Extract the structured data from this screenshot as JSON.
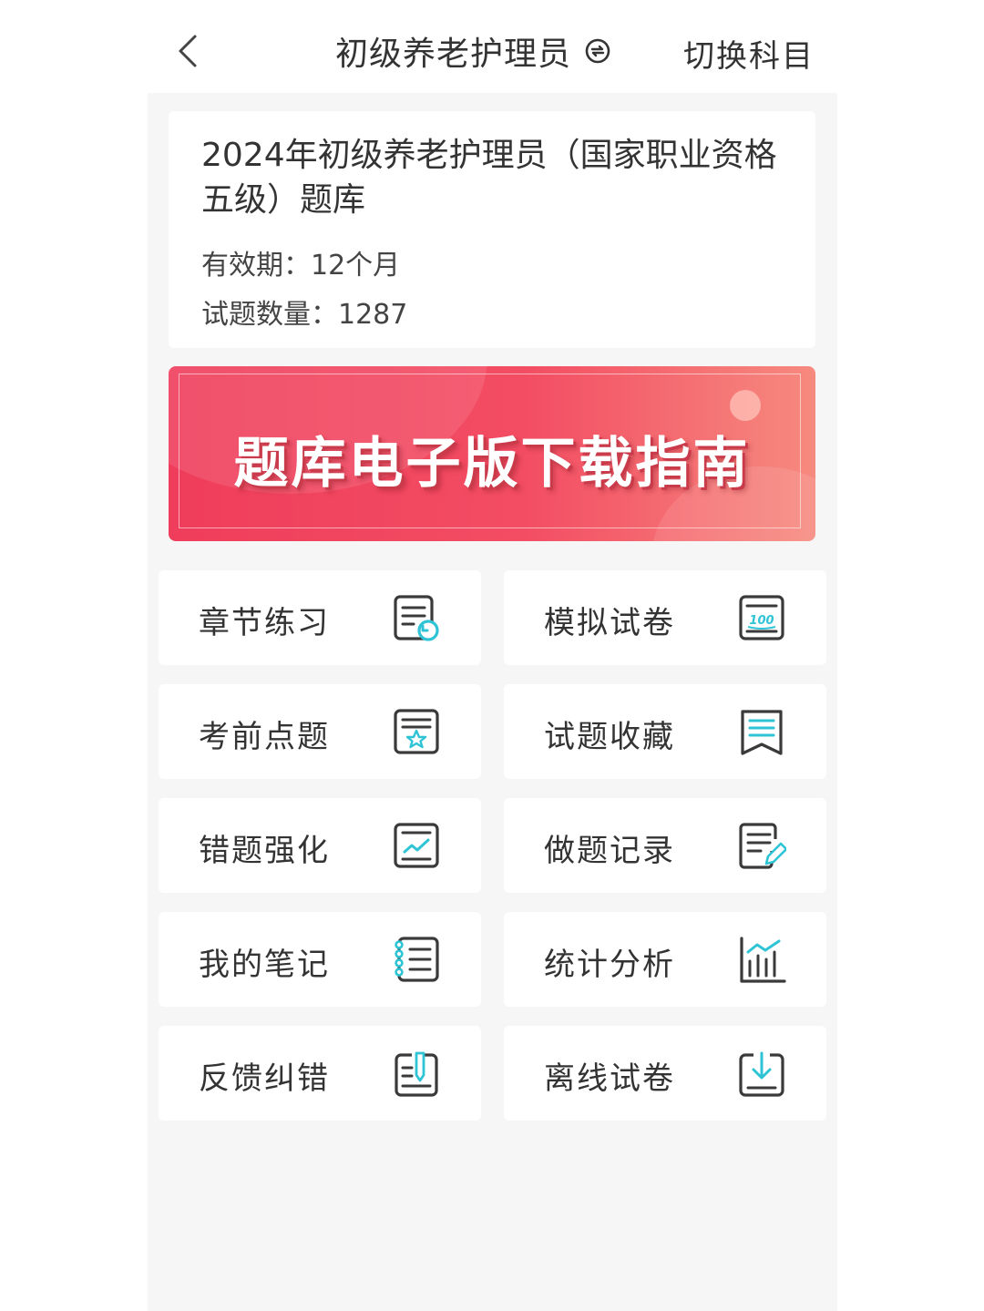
{
  "header": {
    "title": "初级养老护理员",
    "switch_label": "切换科目"
  },
  "info": {
    "title": "2024年初级养老护理员（国家职业资格五级）题库",
    "validity": "有效期：12个月",
    "question_count": "试题数量：1287"
  },
  "banner": {
    "text": "题库电子版下载指南"
  },
  "menu": [
    {
      "label": "章节练习",
      "icon": "chapter-practice-icon"
    },
    {
      "label": "模拟试卷",
      "icon": "mock-exam-icon"
    },
    {
      "label": "考前点题",
      "icon": "pre-exam-tips-icon"
    },
    {
      "label": "试题收藏",
      "icon": "bookmark-icon"
    },
    {
      "label": "错题强化",
      "icon": "wrong-question-icon"
    },
    {
      "label": "做题记录",
      "icon": "record-edit-icon"
    },
    {
      "label": "我的笔记",
      "icon": "notebook-icon"
    },
    {
      "label": "统计分析",
      "icon": "bar-chart-icon"
    },
    {
      "label": "反馈纠错",
      "icon": "feedback-icon"
    },
    {
      "label": "离线试卷",
      "icon": "download-icon"
    }
  ],
  "colors": {
    "accent": "#2ec4d6",
    "icon_stroke": "#3a3a3a",
    "banner_red": "#ef3d5b",
    "banner_pink": "#f68a7f",
    "background": "#f6f6f7"
  }
}
